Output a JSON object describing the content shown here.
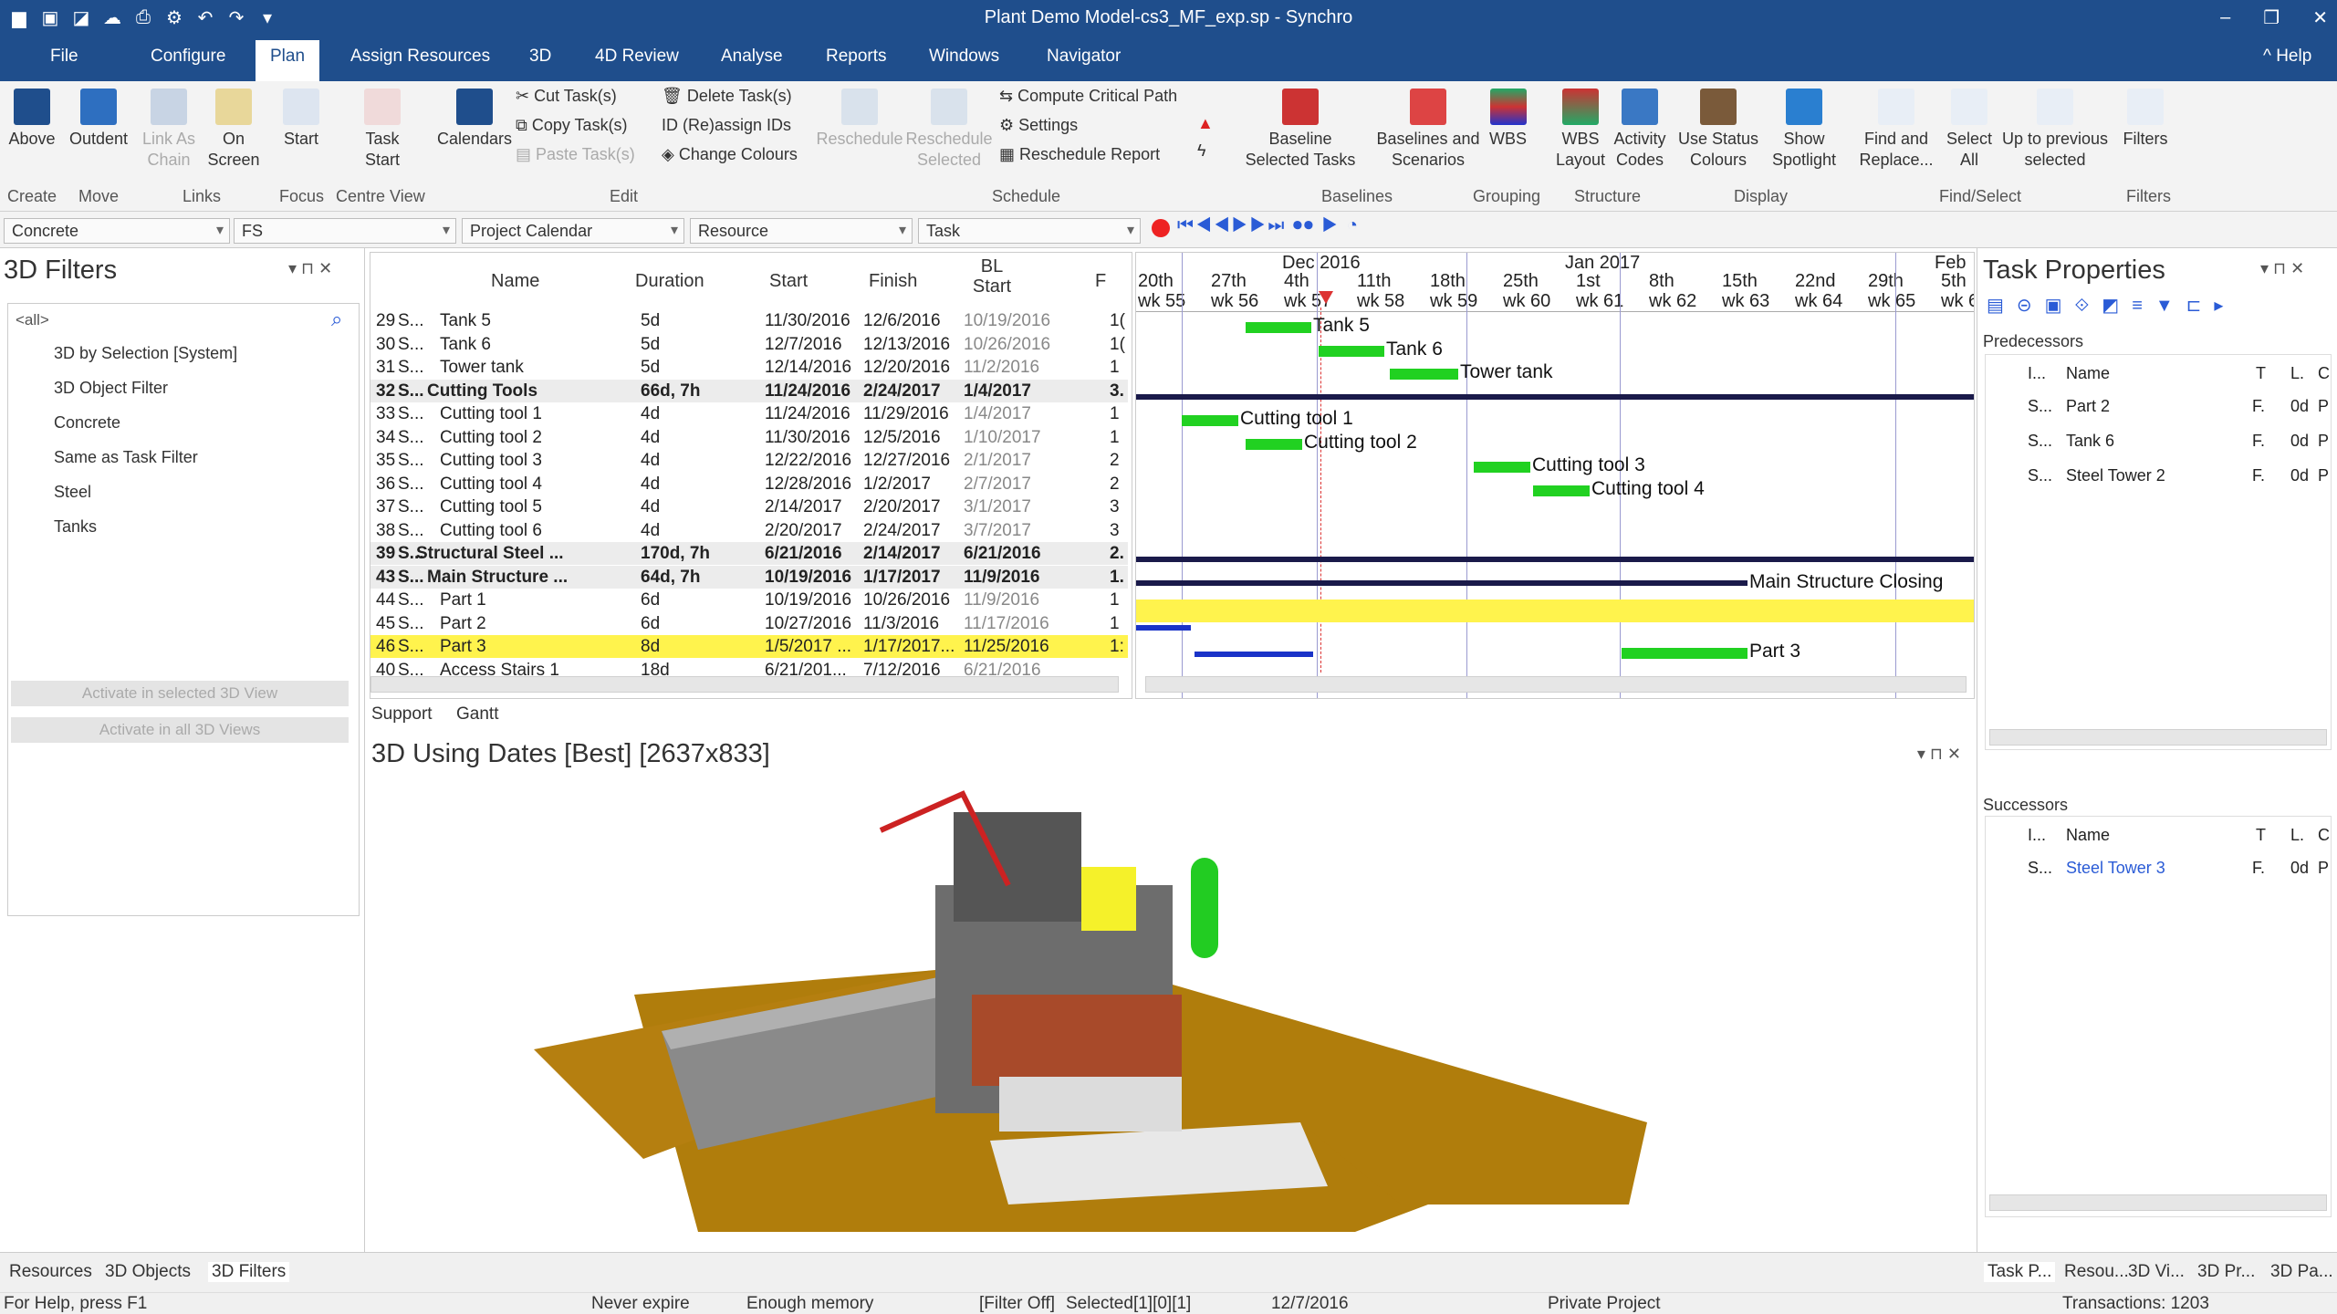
{
  "window": {
    "title": "Plant Demo Model-cs3_MF_exp.sp - Synchro",
    "help": "Help"
  },
  "menu": [
    "File",
    "Configure",
    "Plan",
    "Assign Resources",
    "3D",
    "4D Review",
    "Analyse",
    "Reports",
    "Windows",
    "Navigator"
  ],
  "ribbon": {
    "above": "Above",
    "outdent": "Outdent",
    "link_as_chain": "Link As Chain",
    "on_screen": "On Screen",
    "start": "Start",
    "task_start": "Task Start",
    "calendars": "Calendars",
    "cut": "Cut Task(s)",
    "copy": "Copy Task(s)",
    "paste": "Paste Task(s)",
    "delete": "Delete Task(s)",
    "reassign": "(Re)assign IDs",
    "change_colours": "Change Colours",
    "reschedule": "Reschedule",
    "reschedule_selected": "Reschedule Selected",
    "compute_cp": "Compute Critical Path",
    "settings": "Settings",
    "reschedule_report": "Reschedule Report",
    "baseline_selected": "Baseline Selected Tasks",
    "baselines_scenarios": "Baselines and Scenarios",
    "wbs": "WBS",
    "wbs_layout": "WBS Layout",
    "activity_codes": "Activity Codes",
    "use_status_colours": "Use Status Colours",
    "show_spotlight": "Show Spotlight",
    "find_replace": "Find and Replace...",
    "select_all": "Select All",
    "up_prev": "Up to previous selected",
    "filters": "Filters",
    "groups": {
      "create": "Create",
      "move": "Move",
      "links": "Links",
      "focus": "Focus",
      "centre_view": "Centre View",
      "edit": "Edit",
      "schedule": "Schedule",
      "baselines": "Baselines",
      "grouping": "Grouping",
      "structure": "Structure",
      "display": "Display",
      "find_select": "Find/Select",
      "filters": "Filters"
    }
  },
  "combos": {
    "resource_type": "Concrete",
    "link_type": "FS",
    "calendar": "Project Calendar",
    "resource": "Resource",
    "task": "Task"
  },
  "filters_panel": {
    "title": "3D Filters",
    "search_value": "<all>",
    "items": [
      "3D by Selection [System]",
      "3D Object Filter",
      "Concrete",
      "Same as Task Filter",
      "Steel",
      "Tanks"
    ],
    "activate_selected": "Activate in selected 3D View",
    "activate_all": "Activate in all 3D Views"
  },
  "grid": {
    "headers": {
      "name": "Name",
      "duration": "Duration",
      "start": "Start",
      "finish": "Finish",
      "bl_start": "BL Start",
      "f": "F"
    },
    "rows": [
      {
        "id": "29",
        "s": "S...",
        "name": "Tank 5",
        "duration": "5d",
        "start": "11/30/2016",
        "finish": "12/6/2016",
        "bl": "10/19/2016",
        "f": "1("
      },
      {
        "id": "30",
        "s": "S...",
        "name": "Tank 6",
        "duration": "5d",
        "start": "12/7/2016",
        "finish": "12/13/2016",
        "bl": "10/26/2016",
        "f": "1("
      },
      {
        "id": "31",
        "s": "S...",
        "name": "Tower tank",
        "duration": "5d",
        "start": "12/14/2016",
        "finish": "12/20/2016",
        "bl": "11/2/2016",
        "f": "1"
      },
      {
        "id": "32",
        "s": "S...",
        "name": "Cutting Tools",
        "duration": "66d, 7h",
        "start": "11/24/2016",
        "finish": "2/24/2017",
        "bl": "1/4/2017",
        "f": "3."
      },
      {
        "id": "33",
        "s": "S...",
        "name": "Cutting tool 1",
        "duration": "4d",
        "start": "11/24/2016",
        "finish": "11/29/2016",
        "bl": "1/4/2017",
        "f": "1"
      },
      {
        "id": "34",
        "s": "S...",
        "name": "Cutting tool 2",
        "duration": "4d",
        "start": "11/30/2016",
        "finish": "12/5/2016",
        "bl": "1/10/2017",
        "f": "1"
      },
      {
        "id": "35",
        "s": "S...",
        "name": "Cutting tool 3",
        "duration": "4d",
        "start": "12/22/2016",
        "finish": "12/27/2016",
        "bl": "2/1/2017",
        "f": "2"
      },
      {
        "id": "36",
        "s": "S...",
        "name": "Cutting tool 4",
        "duration": "4d",
        "start": "12/28/2016",
        "finish": "1/2/2017",
        "bl": "2/7/2017",
        "f": "2"
      },
      {
        "id": "37",
        "s": "S...",
        "name": "Cutting tool 5",
        "duration": "4d",
        "start": "2/14/2017",
        "finish": "2/20/2017",
        "bl": "3/1/2017",
        "f": "3"
      },
      {
        "id": "38",
        "s": "S...",
        "name": "Cutting tool 6",
        "duration": "4d",
        "start": "2/20/2017",
        "finish": "2/24/2017",
        "bl": "3/7/2017",
        "f": "3"
      },
      {
        "id": "39",
        "s": "S...",
        "name": "Structural Steel ...",
        "duration": "170d, 7h",
        "start": "6/21/2016",
        "finish": "2/14/2017",
        "bl": "6/21/2016",
        "f": "2."
      },
      {
        "id": "43",
        "s": "S...",
        "name": "Main Structure ...",
        "duration": "64d, 7h",
        "start": "10/19/2016",
        "finish": "1/17/2017",
        "bl": "11/9/2016",
        "f": "1."
      },
      {
        "id": "44",
        "s": "S...",
        "name": "Part 1",
        "duration": "6d",
        "start": "10/19/2016",
        "finish": "10/26/2016",
        "bl": "11/9/2016",
        "f": "1"
      },
      {
        "id": "45",
        "s": "S...",
        "name": "Part 2",
        "duration": "6d",
        "start": "10/27/2016",
        "finish": "11/3/2016",
        "bl": "11/17/2016",
        "f": "1"
      },
      {
        "id": "46",
        "s": "S...",
        "name": "Part 3",
        "duration": "8d",
        "start": "1/5/2017 ...",
        "finish": "1/17/2017...",
        "bl": "11/25/2016",
        "f": "1:"
      },
      {
        "id": "40",
        "s": "S...",
        "name": "Access Stairs 1",
        "duration": "18d",
        "start": "6/21/201...",
        "finish": "7/12/2016",
        "bl": "6/21/2016",
        "f": ""
      }
    ]
  },
  "gantt": {
    "months": [
      "Dec 2016",
      "Jan 2017",
      "Feb"
    ],
    "days": [
      "20th",
      "27th",
      "4th",
      "11th",
      "18th",
      "25th",
      "1st",
      "8th",
      "15th",
      "22nd",
      "29th",
      "5th"
    ],
    "weeks": [
      "wk 55",
      "wk 56",
      "wk 57",
      "wk 58",
      "wk 59",
      "wk 60",
      "wk 61",
      "wk 62",
      "wk 63",
      "wk 64",
      "wk 65",
      "wk 6"
    ],
    "labels": [
      "Tank 5",
      "Tank 6",
      "Tower tank",
      "Cutting tool 1",
      "Cutting tool 2",
      "Cutting tool 3",
      "Cutting tool 4",
      "Main Structure Closing",
      "Part 3"
    ]
  },
  "tabs_a": [
    "Support",
    "Gantt"
  ],
  "view3d": {
    "title": "3D Using Dates [Best] [2637x833]"
  },
  "props": {
    "title": "Task Properties",
    "pred_title": "Predecessors",
    "succ_title": "Successors",
    "col_i": "I...",
    "col_name": "Name",
    "col_t": "T",
    "col_l": "L.",
    "col_c": "C",
    "predecessors": [
      {
        "s": "S...",
        "name": "Part 2",
        "t": "F.",
        "l": "0d",
        "c": "P"
      },
      {
        "s": "S...",
        "name": "Tank 6",
        "t": "F.",
        "l": "0d",
        "c": "P"
      },
      {
        "s": "S...",
        "name": "Steel Tower 2",
        "t": "F.",
        "l": "0d",
        "c": "P"
      }
    ],
    "successors": [
      {
        "s": "S...",
        "name": "Steel Tower 3",
        "t": "F.",
        "l": "0d",
        "c": "P"
      }
    ]
  },
  "bottom_tabs_left": [
    "Resources",
    "3D Objects",
    "3D Filters"
  ],
  "bottom_tabs_right": [
    "Task P...",
    "Resou...",
    "3D Vi...",
    "3D Pr...",
    "3D Pa..."
  ],
  "status": {
    "help": "For Help, press F1",
    "expire": "Never expire",
    "memory": "Enough memory",
    "filter": "[Filter Off]",
    "selected": "Selected[1][0][1]",
    "date": "12/7/2016",
    "project": "Private Project",
    "transactions": "Transactions: 1203"
  },
  "colors": {
    "brand": "#1f4e8c",
    "bar": "#21d121",
    "baseline": "#1a33c8",
    "selection": "#fff34d",
    "ground": "#b07d0c"
  }
}
